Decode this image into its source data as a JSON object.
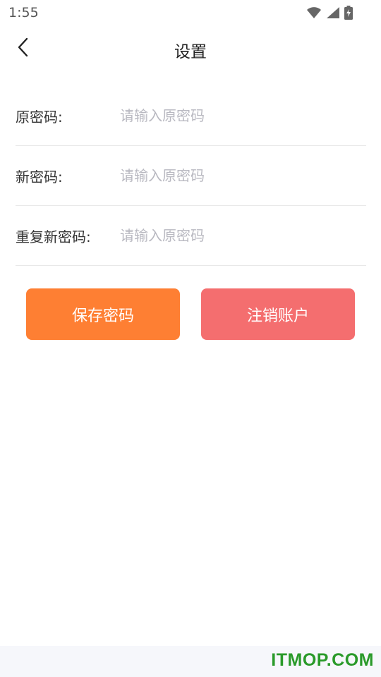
{
  "status_bar": {
    "time": "1:55",
    "icons": [
      "wifi-icon",
      "signal-icon",
      "battery-charging-icon"
    ]
  },
  "header": {
    "title": "设置",
    "back_icon": "chevron-left-icon"
  },
  "form": {
    "fields": [
      {
        "label": "原密码:",
        "placeholder": "请输入原密码",
        "value": ""
      },
      {
        "label": "新密码:",
        "placeholder": "请输入原密码",
        "value": ""
      },
      {
        "label": "重复新密码:",
        "placeholder": "请输入原密码",
        "value": ""
      }
    ]
  },
  "actions": {
    "save_label": "保存密码",
    "cancel_account_label": "注销账户"
  },
  "footer": {
    "watermark": "ITMOP.COM"
  },
  "colors": {
    "save_button": "#fe7f33",
    "cancel_account_button": "#f46e6f",
    "placeholder": "#b9b9c1",
    "divider": "#e8e8e8",
    "watermark": "#2a9a2a"
  }
}
